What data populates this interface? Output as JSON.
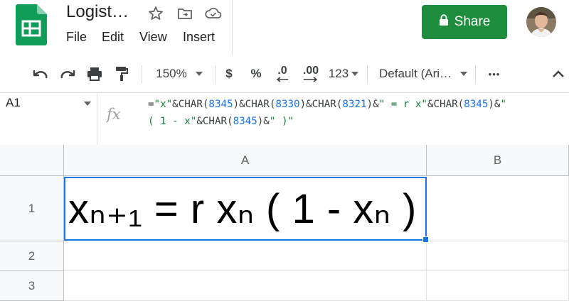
{
  "app": {
    "title": "Logist…",
    "menu": [
      "File",
      "Edit",
      "View",
      "Insert"
    ],
    "share_label": "Share",
    "colors": {
      "share": "#1e8e3e",
      "selection": "#1a73e8",
      "logo": "#0f9d58"
    }
  },
  "header_icons": [
    "star-icon",
    "move-to-folder-icon",
    "cloud-status-icon"
  ],
  "toolbar": {
    "zoom": "150%",
    "currency": "$",
    "percent": "%",
    "decrease_decimals": ".0",
    "increase_decimals": ".00",
    "more_formats": "123",
    "font": "Default (Ari…",
    "more": "•••",
    "icons": [
      "undo-icon",
      "redo-icon",
      "print-icon",
      "paint-format-icon",
      "collapse-icon"
    ]
  },
  "formula_bar": {
    "cell_ref": "A1",
    "fx": "fx",
    "line1": [
      {
        "t": "=",
        "k": "op"
      },
      {
        "t": "\"x\"",
        "k": "str"
      },
      {
        "t": "&CHAR(",
        "k": "op"
      },
      {
        "t": "8345",
        "k": "num"
      },
      {
        "t": ")&CHAR(",
        "k": "op"
      },
      {
        "t": "8330",
        "k": "num"
      },
      {
        "t": ")&CHAR(",
        "k": "op"
      },
      {
        "t": "8321",
        "k": "num"
      },
      {
        "t": ")&",
        "k": "op"
      },
      {
        "t": "\" = r x\"",
        "k": "str"
      },
      {
        "t": "&CHAR(",
        "k": "op"
      },
      {
        "t": "8345",
        "k": "num"
      },
      {
        "t": ")&",
        "k": "op"
      },
      {
        "t": "\"",
        "k": "str"
      }
    ],
    "line2": [
      {
        "t": "( 1 - x\"",
        "k": "str"
      },
      {
        "t": "&CHAR(",
        "k": "op"
      },
      {
        "t": "8345",
        "k": "num"
      },
      {
        "t": ")&",
        "k": "op"
      },
      {
        "t": "\" )\"",
        "k": "str"
      }
    ]
  },
  "grid": {
    "columns": [
      "A",
      "B"
    ],
    "rows": [
      "1",
      "2",
      "3"
    ],
    "cell_a1": "xₙ₊₁ = r xₙ ( 1 - xₙ )"
  }
}
